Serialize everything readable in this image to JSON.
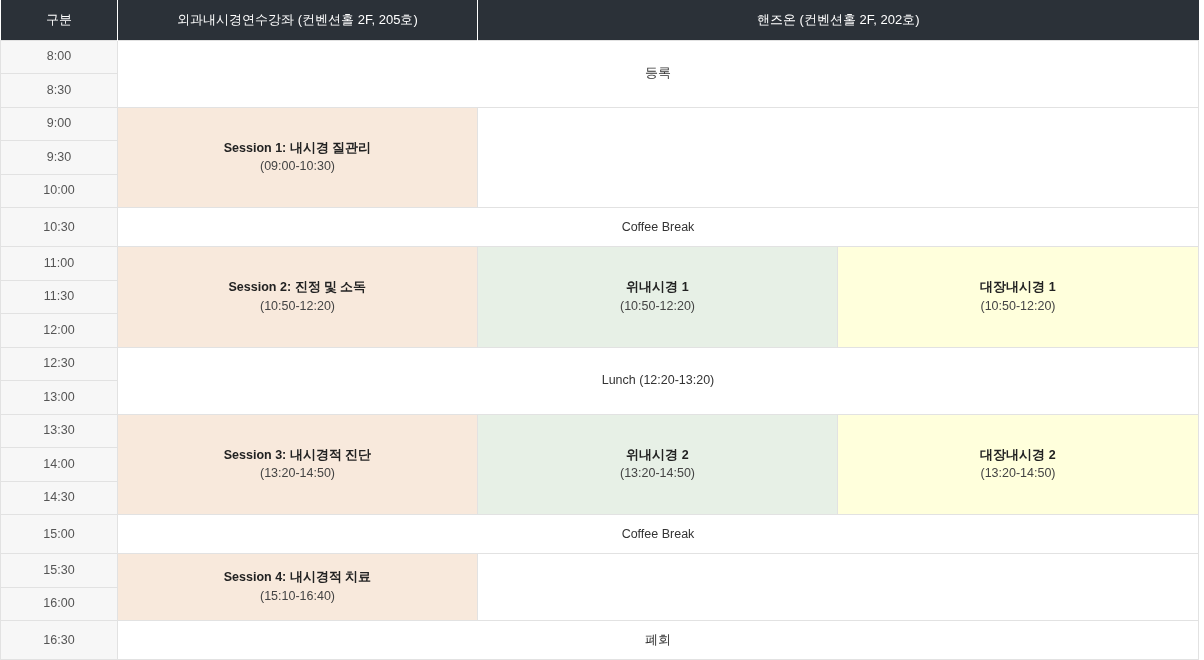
{
  "header": [
    {
      "label": "구분"
    },
    {
      "label": "외과내시경연수강좌 (컨벤션홀 2F, 205호)"
    },
    {
      "label": "핸즈온 (컨벤션홀 2F, 202호)"
    }
  ],
  "blocks": [
    {
      "times": [
        "8:00",
        "8:30"
      ],
      "cells": [
        {
          "kind": "event",
          "title": "등록"
        }
      ]
    },
    {
      "times": [
        "9:00",
        "9:30",
        "10:00"
      ],
      "cells": [
        {
          "kind": "lecture",
          "title": "Session 1: 내시경 질관리",
          "time": "(09:00-10:30)"
        }
      ]
    },
    {
      "times": [
        "10:30"
      ],
      "cells": [
        {
          "kind": "event",
          "title": "Coffee Break"
        }
      ]
    },
    {
      "times": [
        "11:00",
        "11:30",
        "12:00"
      ],
      "cells": [
        {
          "kind": "lecture",
          "title": "Session 2: 진정 및 소독",
          "time": "(10:50-12:20)"
        },
        {
          "kind": "gastro",
          "title": "위내시경 1",
          "time": "(10:50-12:20)"
        },
        {
          "kind": "colon",
          "title": "대장내시경 1",
          "time": "(10:50-12:20)"
        }
      ]
    },
    {
      "times": [
        "12:30",
        "13:00"
      ],
      "cells": [
        {
          "kind": "event",
          "title": "Lunch (12:20-13:20)"
        }
      ]
    },
    {
      "times": [
        "13:30",
        "14:00",
        "14:30"
      ],
      "cells": [
        {
          "kind": "lecture",
          "title": "Session 3: 내시경적 진단",
          "time": "(13:20-14:50)"
        },
        {
          "kind": "gastro",
          "title": "위내시경 2",
          "time": "(13:20-14:50)"
        },
        {
          "kind": "colon",
          "title": "대장내시경 2",
          "time": "(13:20-14:50)"
        }
      ]
    },
    {
      "times": [
        "15:00"
      ],
      "cells": [
        {
          "kind": "event",
          "title": "Coffee Break"
        }
      ]
    },
    {
      "times": [
        "15:30",
        "16:00"
      ],
      "cells": [
        {
          "kind": "lecture",
          "title": "Session 4: 내시경적 치료",
          "time": "(15:10-16:40)"
        }
      ]
    },
    {
      "times": [
        "16:30"
      ],
      "cells": [
        {
          "kind": "event",
          "title": "폐회"
        }
      ]
    }
  ]
}
